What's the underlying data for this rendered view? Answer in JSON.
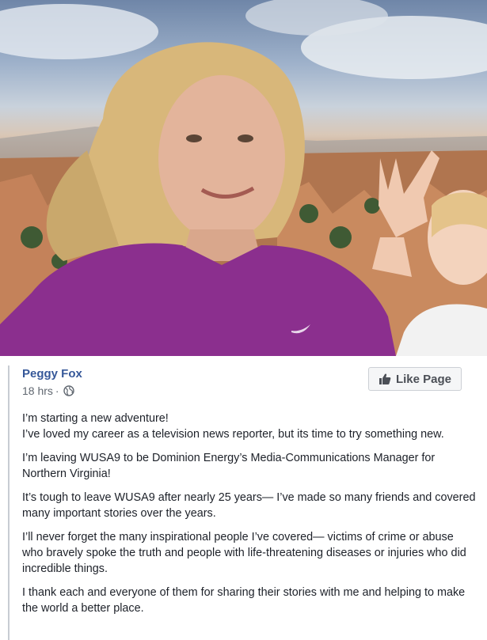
{
  "photo": {
    "description_icon": "selfie-photo"
  },
  "post": {
    "author": "Peggy Fox",
    "time": "18 hrs",
    "separator": "·",
    "privacy_icon": "globe-icon",
    "like_page_label": "Like Page",
    "paragraphs": [
      "I’m starting a new adventure!",
      "I’ve loved my career as a television news reporter, but its time to try something new.",
      "I’m leaving WUSA9 to be Dominion Energy’s Media-Communications Manager for Northern Virginia!",
      "It’s tough to leave WUSA9 after nearly 25 years— I’ve made so many friends and covered many important stories over the years.",
      "I’ll never forget the many inspirational people I’ve covered— victims of crime or abuse who bravely spoke the truth and people with life-threatening diseases or injuries who did incredible things.",
      "I thank each and everyone of them for sharing their stories with me and helping to make the world a better place."
    ]
  },
  "colors": {
    "author_link": "#365899",
    "meta_text": "#606770",
    "body_text": "#1d2129",
    "button_bg": "#f5f6f7",
    "border": "#ccd0d5"
  }
}
